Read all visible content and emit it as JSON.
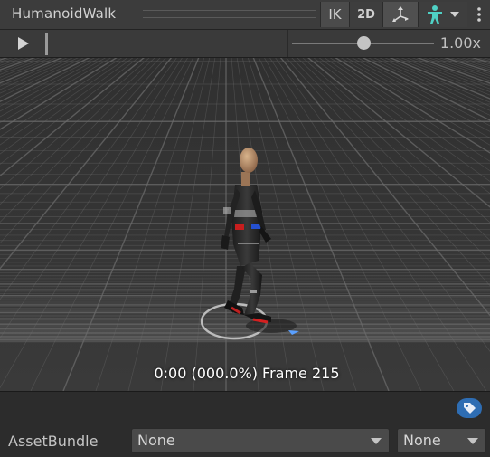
{
  "header": {
    "title": "HumanoidWalk",
    "ik_label": "IK",
    "two_d_label": "2D",
    "gizmo_icon": "pivot-gizmo-icon",
    "avatar_icon": "avatar-humanoid-icon",
    "more_icon": "kebab-menu-icon"
  },
  "transport": {
    "play_icon": "play-icon",
    "speed_slider": 0.5,
    "speed_label": "1.00x"
  },
  "viewport": {
    "caption": "0:00 (000.0%) Frame 215"
  },
  "bottom": {
    "assetbundle_label": "AssetBundle",
    "assetbundle_value": "None",
    "variant_value": "None",
    "tag_icon": "label-tag-icon"
  },
  "colors": {
    "accent": "#2e6db3",
    "avatar": "#4fd1c5",
    "background": "#313131"
  }
}
